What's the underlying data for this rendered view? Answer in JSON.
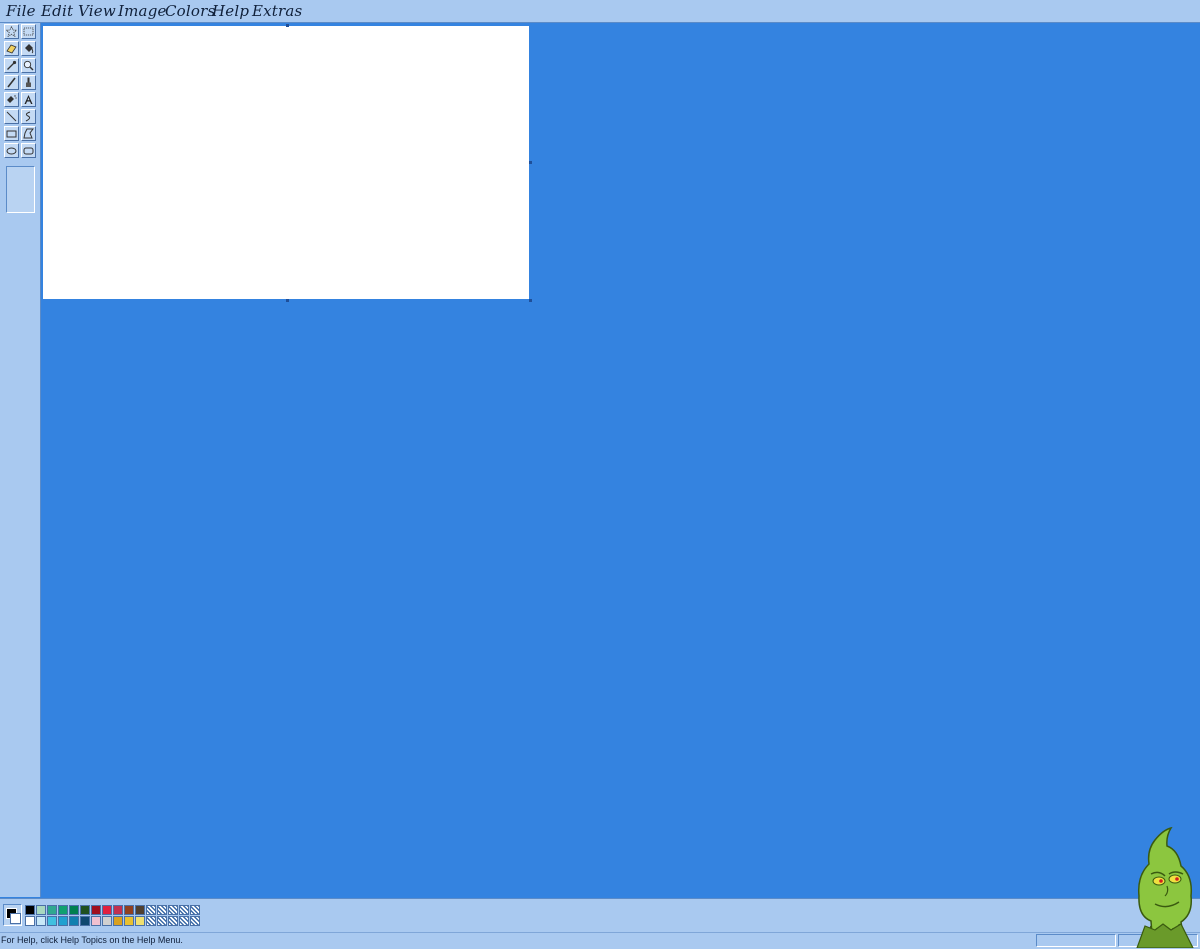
{
  "menu": {
    "items": [
      {
        "label": "File"
      },
      {
        "label": "Edit"
      },
      {
        "label": "View"
      },
      {
        "label": "Image"
      },
      {
        "label": "Colors"
      },
      {
        "label": "Help"
      },
      {
        "label": "Extras"
      }
    ]
  },
  "toolbox": {
    "tools": [
      {
        "name": "free-form-select",
        "icon": "star-select-icon"
      },
      {
        "name": "rect-select",
        "icon": "rect-select-icon"
      },
      {
        "name": "eraser",
        "icon": "eraser-icon"
      },
      {
        "name": "fill",
        "icon": "fill-bucket-icon"
      },
      {
        "name": "pick-color",
        "icon": "eyedropper-icon"
      },
      {
        "name": "magnifier",
        "icon": "magnifier-icon"
      },
      {
        "name": "pencil",
        "icon": "pencil-icon"
      },
      {
        "name": "brush",
        "icon": "brush-icon"
      },
      {
        "name": "airbrush",
        "icon": "airbrush-icon"
      },
      {
        "name": "text",
        "icon": "text-icon",
        "glyph": "A"
      },
      {
        "name": "line",
        "icon": "line-icon"
      },
      {
        "name": "curve",
        "icon": "curve-icon"
      },
      {
        "name": "rectangle",
        "icon": "rectangle-icon"
      },
      {
        "name": "polygon",
        "icon": "polygon-icon"
      },
      {
        "name": "ellipse",
        "icon": "ellipse-icon"
      },
      {
        "name": "rounded-rectangle",
        "icon": "rounded-rectangle-icon"
      }
    ]
  },
  "palette": {
    "foreground": "#000000",
    "background": "#ffffff",
    "top_row": [
      "#000000",
      "#a8d8c0",
      "#30a890",
      "#10a070",
      "#008050",
      "#205020",
      "#a01020",
      "#e02040",
      "#c03050",
      "#904020",
      "#504030",
      "pattern",
      "pattern",
      "pattern",
      "pattern",
      "pattern"
    ],
    "bottom_row": [
      "#ffffff",
      "#c8e8f8",
      "#40c0e0",
      "#20a0d0",
      "#1080b0",
      "#104870",
      "#f0c0d0",
      "#d0d0d0",
      "#d8a020",
      "#e8c030",
      "#f0e070",
      "pattern",
      "pattern",
      "pattern",
      "pattern",
      "pattern"
    ]
  },
  "status": {
    "help_text": "For Help, click Help Topics on the Help Menu."
  },
  "colors": {
    "workspace": "#3483e0",
    "chrome": "#a9c9f0",
    "canvas": "#ffffff"
  }
}
